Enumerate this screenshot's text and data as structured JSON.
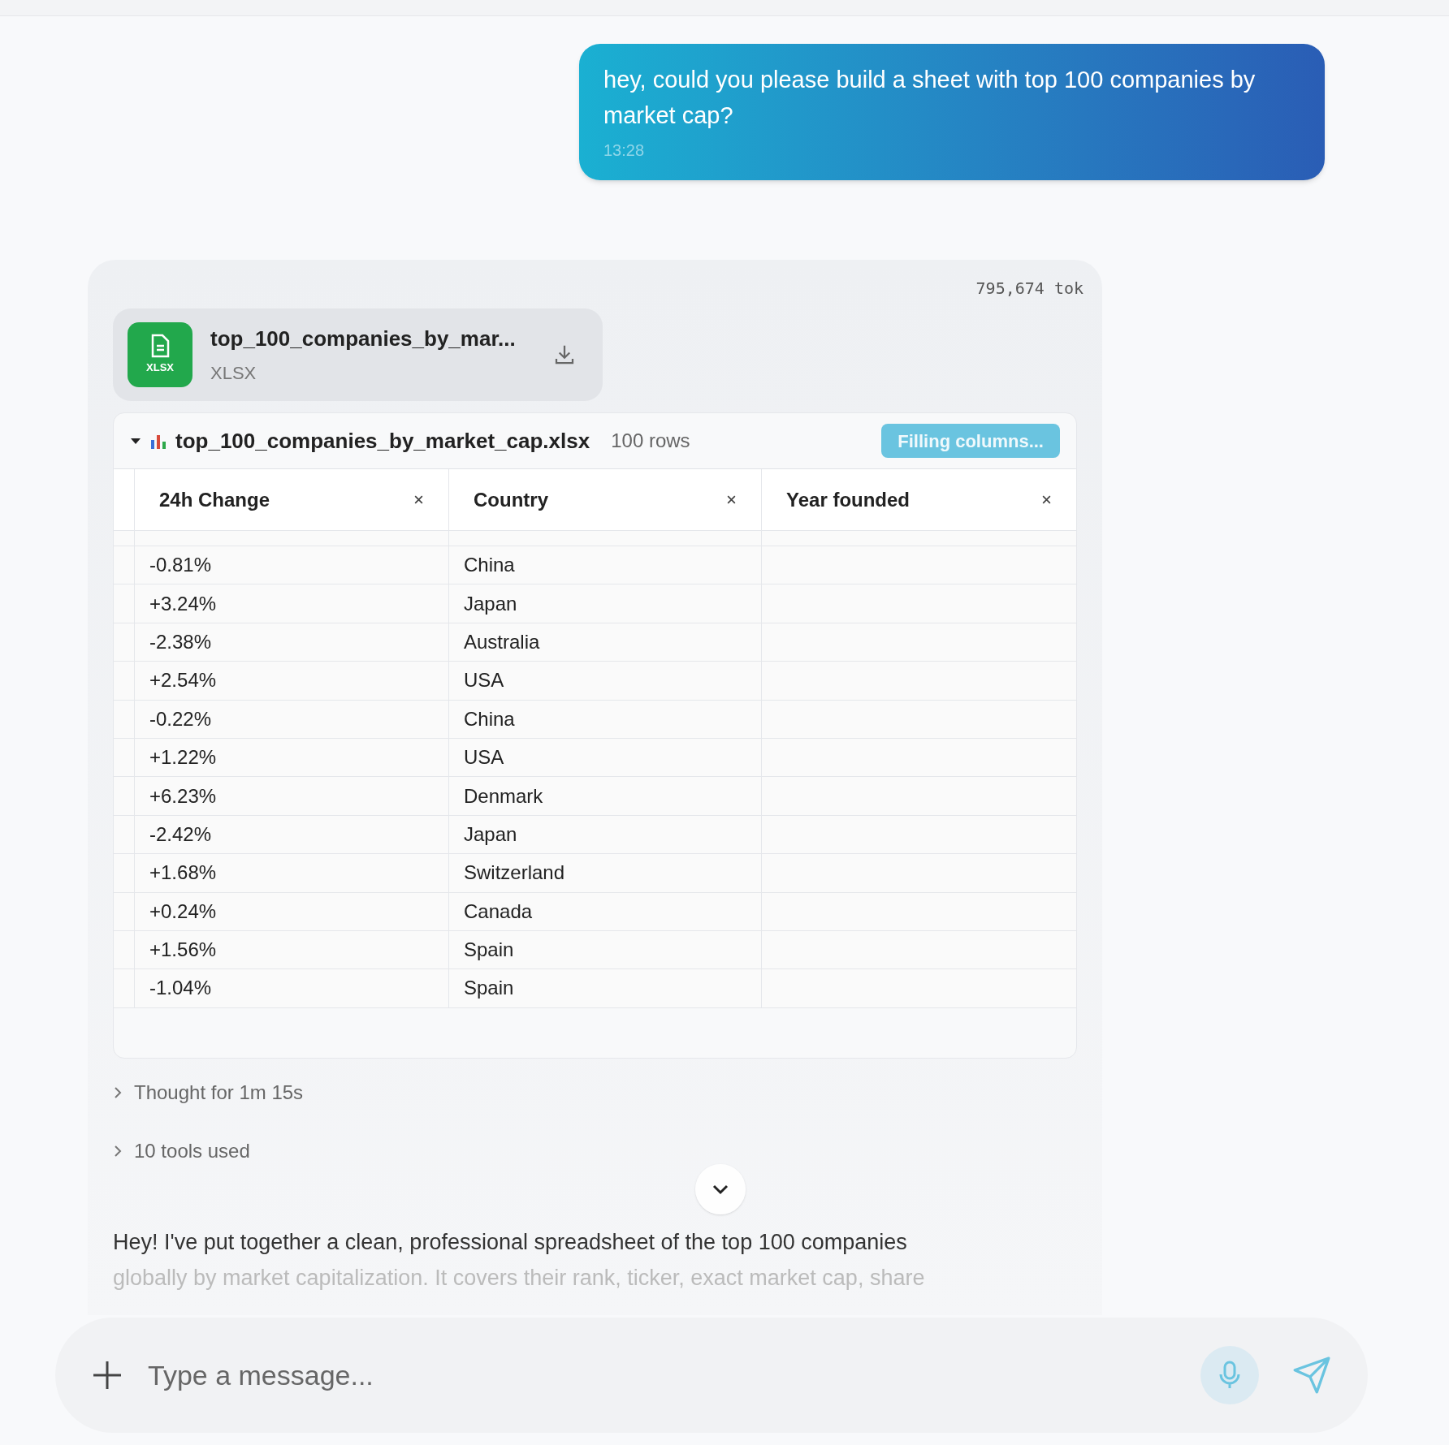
{
  "user_message": {
    "text": "hey, could you please build a sheet with top 100 companies by market cap?",
    "time": "13:28"
  },
  "assistant": {
    "token_count": "795,674 tok",
    "file": {
      "name": "top_100_companies_by_mar...",
      "type": "XLSX",
      "icon_label": "XLSX"
    },
    "sheet": {
      "title": "top_100_companies_by_market_cap.xlsx",
      "row_count": "100 rows",
      "expanded": true,
      "status": "Filling columns...",
      "columns": [
        "24h Change",
        "Country",
        "Year founded"
      ],
      "rows": [
        [
          "-0.81%",
          "China"
        ],
        [
          "+3.24%",
          "Japan"
        ],
        [
          "-2.38%",
          "Australia"
        ],
        [
          "+2.54%",
          "USA"
        ],
        [
          "-0.22%",
          "China"
        ],
        [
          "+1.22%",
          "USA"
        ],
        [
          "+6.23%",
          "Denmark"
        ],
        [
          "-2.42%",
          "Japan"
        ],
        [
          "+1.68%",
          "Switzerland"
        ],
        [
          "+0.24%",
          "Canada"
        ],
        [
          "+1.56%",
          "Spain"
        ],
        [
          "-1.04%",
          "Spain"
        ]
      ]
    },
    "sections": [
      {
        "label": "Thought for 1m 15s",
        "expanded": false
      },
      {
        "label": "10 tools used",
        "expanded": false
      }
    ],
    "paragraph_lines": [
      "Hey! I've put together a clean, professional spreadsheet of the top 100 companies",
      "globally by market capitalization. It covers their rank, ticker, exact market cap, share"
    ]
  },
  "composer": {
    "placeholder": "Type a message..."
  }
}
